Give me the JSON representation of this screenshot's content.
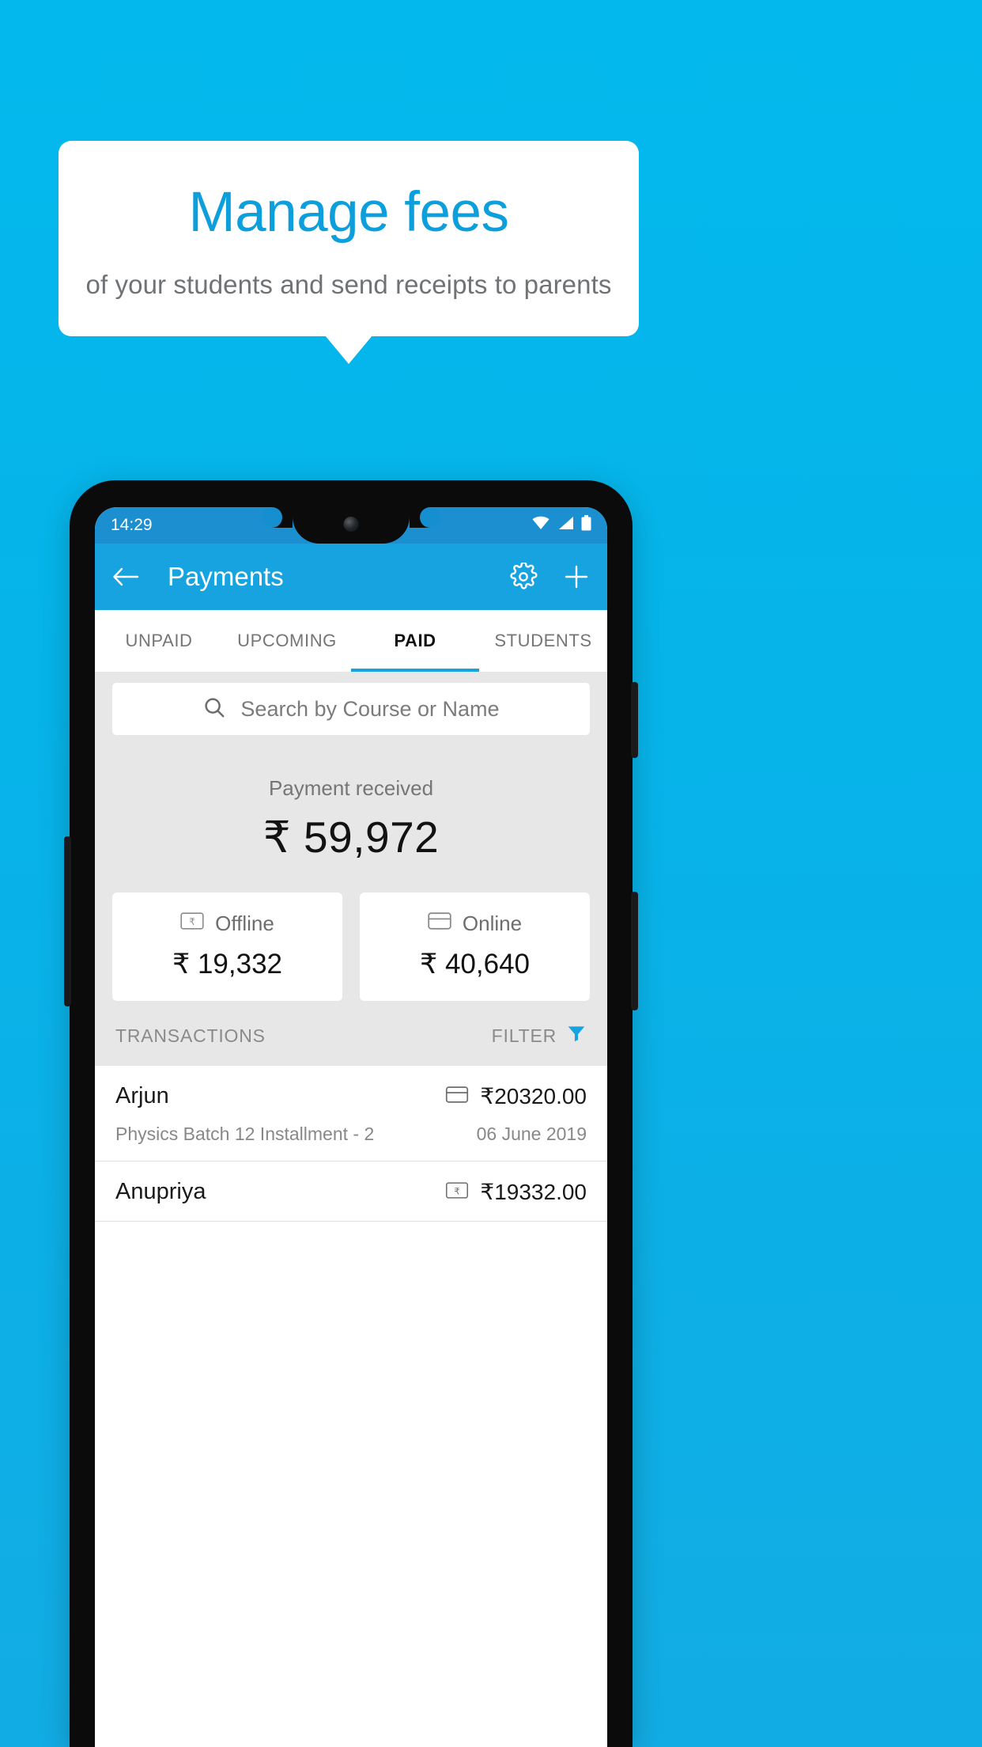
{
  "promo": {
    "title": "Manage fees",
    "subtitle": "of your students and send receipts to parents"
  },
  "colors": {
    "background": "#06b4ea",
    "accent": "#17a2e0",
    "title_blue": "#0d9fdc",
    "statusbar": "#1c8fd1"
  },
  "phone": {
    "statusbar": {
      "time": "14:29",
      "icons": [
        "wifi-icon",
        "signal-icon",
        "battery-icon"
      ]
    },
    "appbar": {
      "back_icon": "arrow-left-icon",
      "title": "Payments",
      "settings_icon": "gear-icon",
      "add_icon": "plus-icon"
    },
    "tabs": [
      {
        "label": "UNPAID",
        "active": false
      },
      {
        "label": "UPCOMING",
        "active": false
      },
      {
        "label": "PAID",
        "active": true
      },
      {
        "label": "STUDENTS",
        "active": false
      }
    ],
    "search": {
      "icon": "search-icon",
      "placeholder": "Search by Course or Name",
      "value": ""
    },
    "summary": {
      "label": "Payment received",
      "amount": "₹ 59,972",
      "cards": [
        {
          "icon": "banknote-rupee-icon",
          "label": "Offline",
          "amount": "₹ 19,332"
        },
        {
          "icon": "credit-card-icon",
          "label": "Online",
          "amount": "₹ 40,640"
        }
      ]
    },
    "transactions_header": {
      "title": "TRANSACTIONS",
      "filter_label": "FILTER",
      "filter_icon": "funnel-icon"
    },
    "transactions": [
      {
        "name": "Arjun",
        "course": "Physics Batch 12 Installment - 2",
        "amount": "₹20320.00",
        "date": "06 June 2019",
        "method_icon": "credit-card-icon"
      },
      {
        "name": "Anupriya",
        "course": "",
        "amount": "₹19332.00",
        "date": "",
        "method_icon": "banknote-rupee-icon"
      }
    ]
  }
}
